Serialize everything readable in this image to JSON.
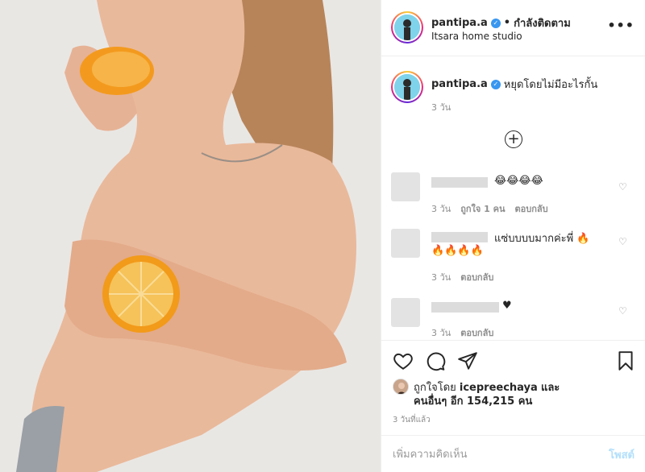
{
  "header": {
    "username": "pantipa.a",
    "separator": "•",
    "follow_label": "กำลังติดตาม",
    "location": "Itsara home studio",
    "more_label": "•••"
  },
  "caption": {
    "username": "pantipa.a",
    "text": "หยุดโดยไม่มีอะไรกั้น",
    "time": "3 วัน"
  },
  "load_more": "+",
  "comments": [
    {
      "text": "😂😂😂😂",
      "time": "3 วัน",
      "likes": "ถูกใจ 1 คน",
      "reply": "ตอบกลับ"
    },
    {
      "text": "แซ่บบบบมากค่ะพี่ 🔥",
      "text2": "🔥🔥🔥🔥",
      "time": "3 วัน",
      "reply": "ตอบกลับ"
    },
    {
      "text": "♥",
      "time": "3 วัน",
      "reply": "ตอบกลับ"
    }
  ],
  "likes": {
    "prefix": "ถูกใจโดย",
    "user": "icepreechaya",
    "and": "และ",
    "others": "คนอื่นๆ อีก 154,215 คน"
  },
  "post_time": "3 วันที่แล้ว",
  "add_comment": {
    "placeholder": "เพิ่มความคิดเห็น",
    "post_label": "โพสต์"
  },
  "icons": {
    "verified": "verified-badge-icon",
    "heart": "heart-icon",
    "comment": "comment-icon",
    "share": "share-icon",
    "save": "bookmark-icon"
  },
  "colors": {
    "verified": "#3897f0",
    "post_disabled": "#b2dffc",
    "muted": "#8e8e8e"
  }
}
